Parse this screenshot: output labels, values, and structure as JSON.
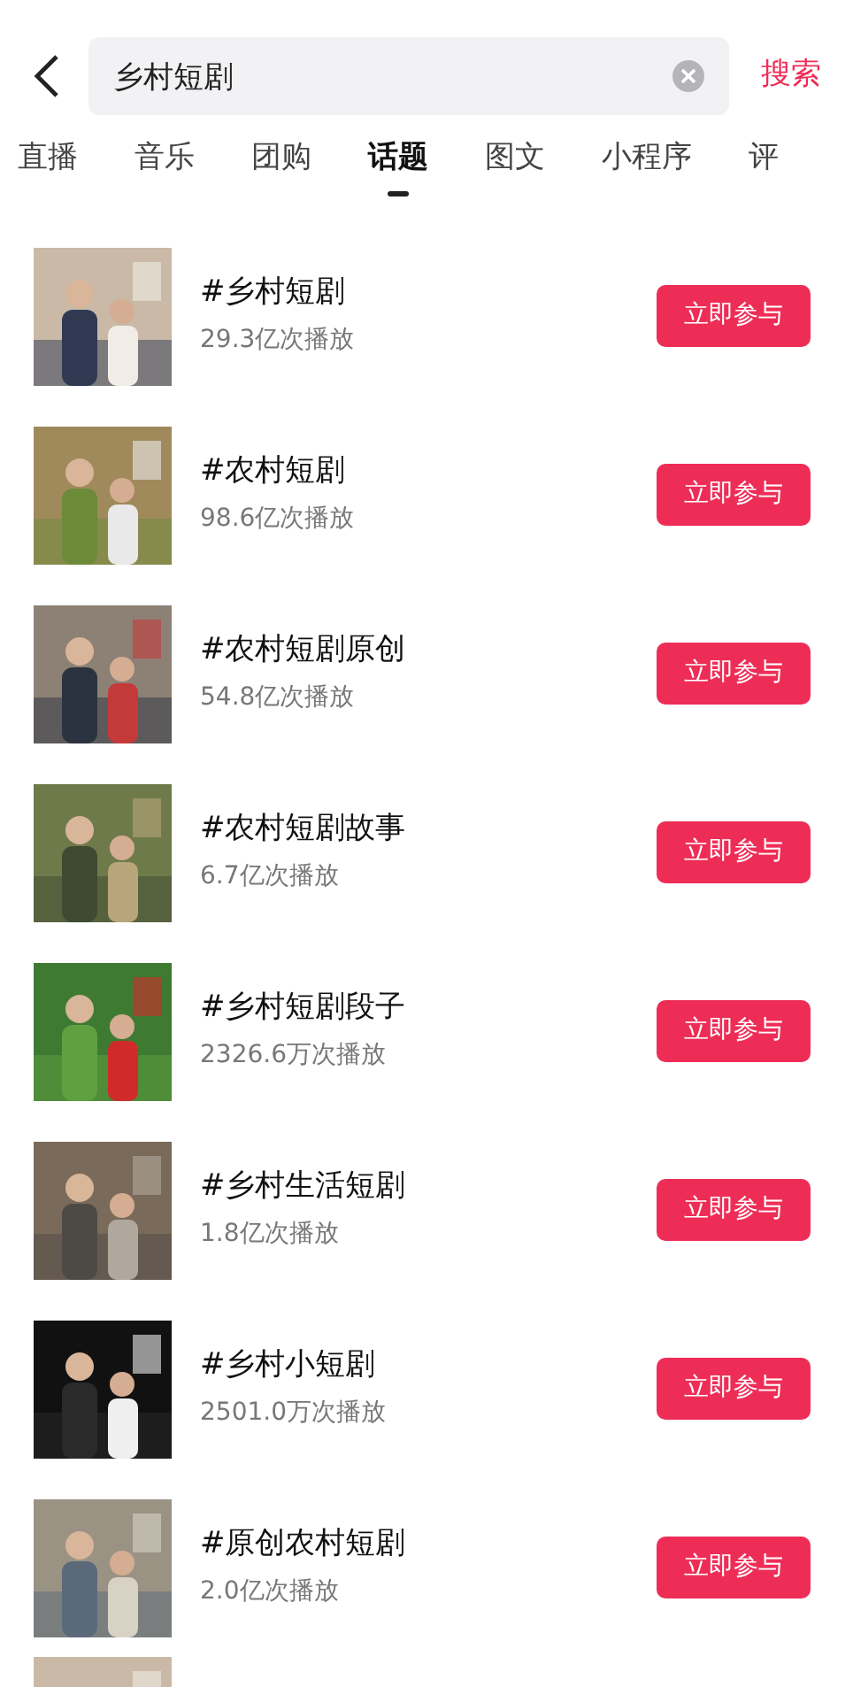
{
  "search": {
    "value": "乡村短剧",
    "submit": "搜索"
  },
  "tabs": [
    {
      "label": "直播",
      "selected": false
    },
    {
      "label": "音乐",
      "selected": false
    },
    {
      "label": "团购",
      "selected": false
    },
    {
      "label": "话题",
      "selected": true
    },
    {
      "label": "图文",
      "selected": false
    },
    {
      "label": "小程序",
      "selected": false
    },
    {
      "label": "评",
      "selected": false
    }
  ],
  "topics": [
    {
      "kind": "topic",
      "title": "#乡村短剧",
      "plays": "29.3亿次播放",
      "button": "立即参与"
    },
    {
      "kind": "topic",
      "title": "#农村短剧",
      "plays": "98.6亿次播放",
      "button": "立即参与"
    },
    {
      "kind": "topic",
      "title": "#农村短剧原创",
      "plays": "54.8亿次播放",
      "button": "立即参与"
    },
    {
      "kind": "topic",
      "title": "#农村短剧故事",
      "plays": "6.7亿次播放",
      "button": "立即参与"
    },
    {
      "kind": "topic",
      "title": "#乡村短剧段子",
      "plays": "2326.6万次播放",
      "button": "立即参与"
    },
    {
      "kind": "topic",
      "title": "#乡村生活短剧",
      "plays": "1.8亿次播放",
      "button": "立即参与"
    },
    {
      "kind": "topic",
      "title": "#乡村小短剧",
      "plays": "2501.0万次播放",
      "button": "立即参与"
    },
    {
      "kind": "topic",
      "title": "#原创农村短剧",
      "plays": "2.0亿次播放",
      "button": "立即参与"
    },
    {
      "kind": "cut-off"
    }
  ]
}
